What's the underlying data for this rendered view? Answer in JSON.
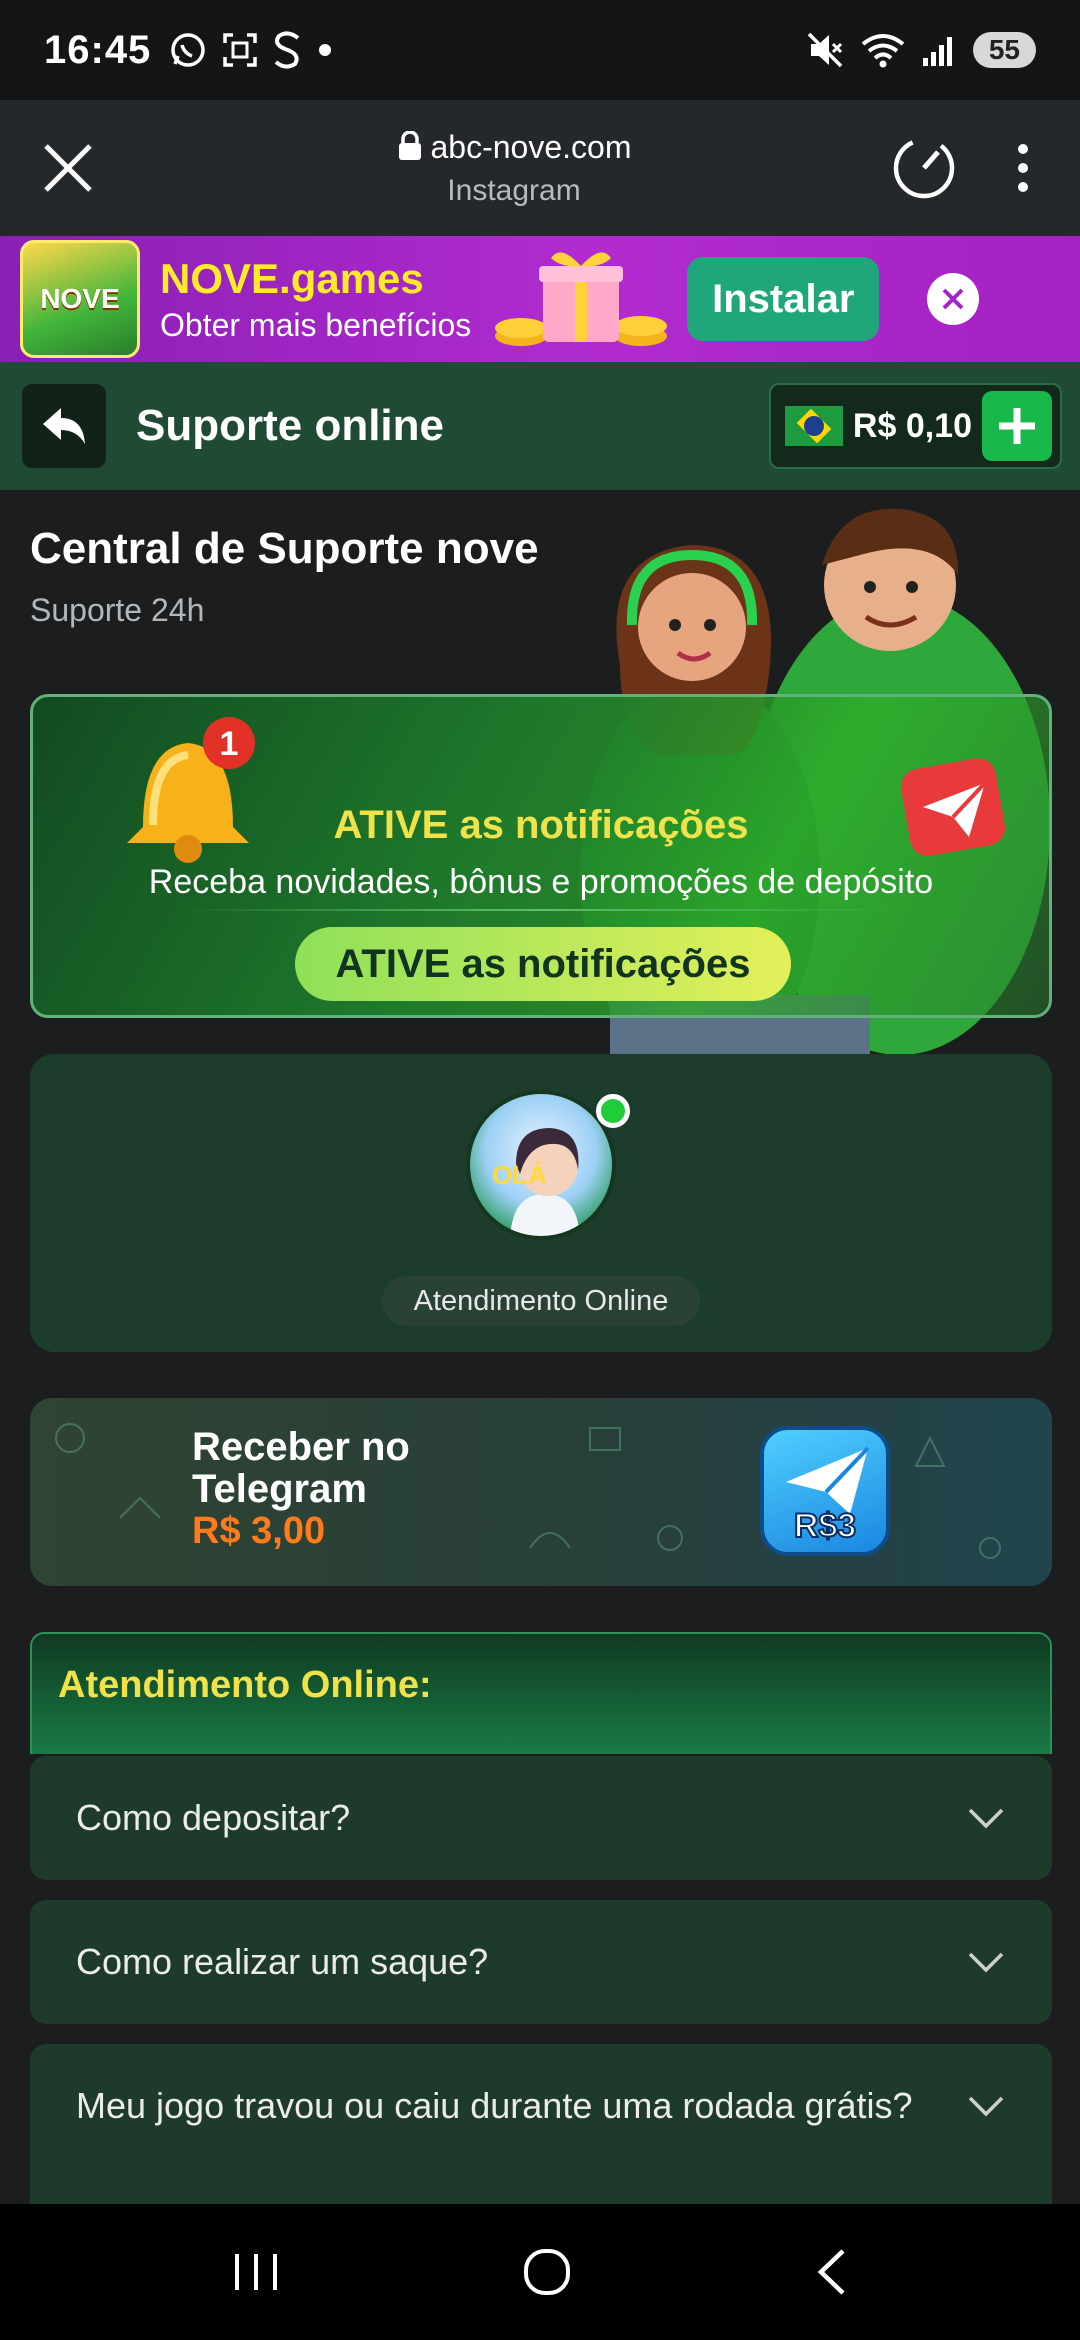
{
  "status_bar": {
    "time": "16:45",
    "left_icons": [
      "whatsapp-icon",
      "screenshot-icon",
      "s-icon",
      "dot-icon"
    ],
    "battery": "55"
  },
  "browser": {
    "url": "abc-nove.com",
    "subtitle": "Instagram"
  },
  "install_banner": {
    "app_icon_text": "NOVE",
    "title": "NOVE.games",
    "subtitle": "Obter mais benefícios",
    "install_label": "Instalar"
  },
  "header": {
    "title": "Suporte online",
    "balance": "R$ 0,10"
  },
  "central": {
    "title": "Central de Suporte nove",
    "subtitle": "Suporte 24h"
  },
  "notification_card": {
    "badge_count": "1",
    "title": "ATIVE as notificações",
    "description": "Receba novidades, bônus e promoções de depósito",
    "button_label": "ATIVE as notificações"
  },
  "agent_card": {
    "avatar_text": "OLÁ",
    "label": "Atendimento Online"
  },
  "telegram_card": {
    "title": "Receber no Telegram",
    "amount": "R$ 3,00",
    "icon_text": "R$3"
  },
  "faq": {
    "header": "Atendimento Online:",
    "items": [
      {
        "question": "Como depositar?"
      },
      {
        "question": "Como realizar um saque?"
      },
      {
        "question": "Meu jogo travou ou caiu durante uma rodada grátis?"
      }
    ]
  },
  "colors": {
    "accent_yellow": "#f1e24a",
    "header_green": "#1f4a33",
    "card_green": "#1d3d2c",
    "amount_orange": "#ff7a1a",
    "banner_purple": "#a421c4"
  }
}
